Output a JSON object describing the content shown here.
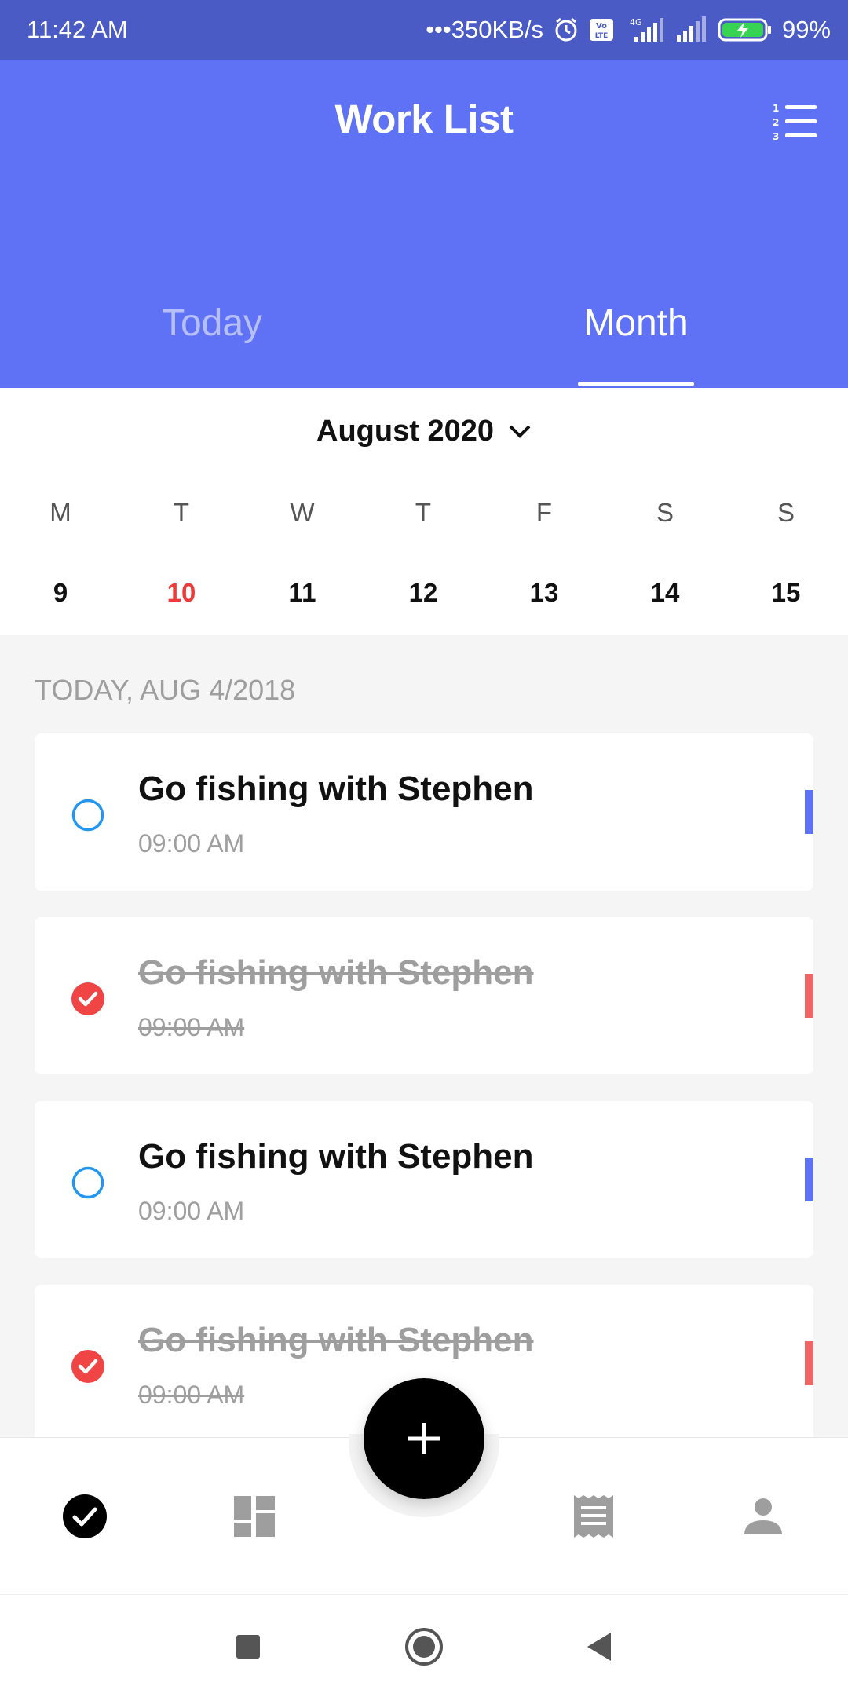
{
  "status_bar": {
    "time": "11:42 AM",
    "network_speed": "•••350KB/s",
    "battery": "99%",
    "icons": [
      "alarm-icon",
      "volte-icon",
      "signal-4g-icon",
      "signal-icon",
      "battery-charging-icon"
    ]
  },
  "header": {
    "title": "Work List",
    "sort_icon": "numbered-list-icon",
    "tabs": [
      {
        "label": "Today",
        "active": false
      },
      {
        "label": "Month",
        "active": true
      }
    ]
  },
  "calendar": {
    "month_label": "August 2020",
    "weekdays": [
      "M",
      "T",
      "W",
      "T",
      "F",
      "S",
      "S"
    ],
    "dates": [
      "9",
      "10",
      "11",
      "12",
      "13",
      "14",
      "15"
    ],
    "today_index": 1
  },
  "task_section": {
    "label": "TODAY, AUG 4/2018",
    "tasks": [
      {
        "title": "Go fishing with Stephen",
        "time": "09:00 AM",
        "done": false,
        "marker_color": "#5f72f5"
      },
      {
        "title": "Go fishing with Stephen",
        "time": "09:00 AM",
        "done": true,
        "marker_color": "#f06565"
      },
      {
        "title": "Go fishing with Stephen",
        "time": "09:00 AM",
        "done": false,
        "marker_color": "#5f72f5"
      },
      {
        "title": "Go fishing with Stephen",
        "time": "09:00 AM",
        "done": true,
        "marker_color": "#f06565"
      }
    ]
  },
  "bottom_nav": {
    "items": [
      "check-circle-icon",
      "dashboard-icon",
      "add-icon",
      "receipt-icon",
      "person-icon"
    ],
    "active_index": 0
  },
  "colors": {
    "header_bg": "#5f72f5",
    "status_bar_bg": "#4a5bc6",
    "today_red": "#ef3a3a",
    "pending_blue": "#2196f3",
    "done_red": "#f04545"
  }
}
